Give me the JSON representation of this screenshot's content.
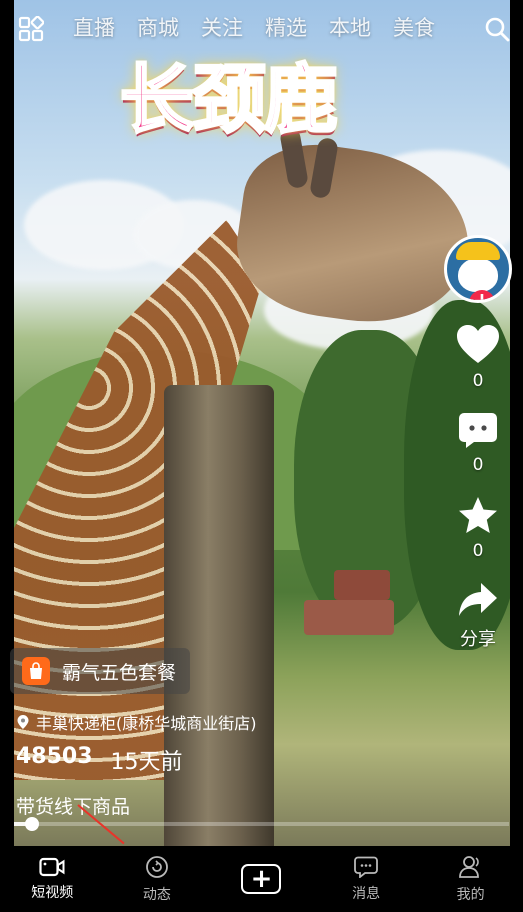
{
  "top_tabs": [
    "直播",
    "商城",
    "关注",
    "精选",
    "本地",
    "美食"
  ],
  "sticker_text": "长颈鹿",
  "rail": {
    "like_count": "0",
    "comment_count": "0",
    "favorite_count": "0",
    "share_label": "分享"
  },
  "product": {
    "name": "霸气五色套餐"
  },
  "location": "丰巢快递柜(康桥华城商业街店)",
  "stats": {
    "views": "48503",
    "posted": "15天前"
  },
  "caption": "带货线下商品",
  "playback_progress_percent": 3,
  "bottom_nav": {
    "short_video": "短视频",
    "feed": "动态",
    "messages": "消息",
    "me": "我的"
  },
  "colors": {
    "accent_red": "#f2294b",
    "product_orange": "#ff6a1a",
    "sticker_pink": "#f23a8a"
  },
  "icons": [
    "grid-menu-icon",
    "search-icon",
    "heart-icon",
    "comment-icon",
    "star-icon",
    "share-icon",
    "shopping-bag-icon",
    "location-pin-icon",
    "video-camera-icon",
    "refresh-circle-icon",
    "plus-icon",
    "chat-bubble-icon",
    "person-icon"
  ]
}
